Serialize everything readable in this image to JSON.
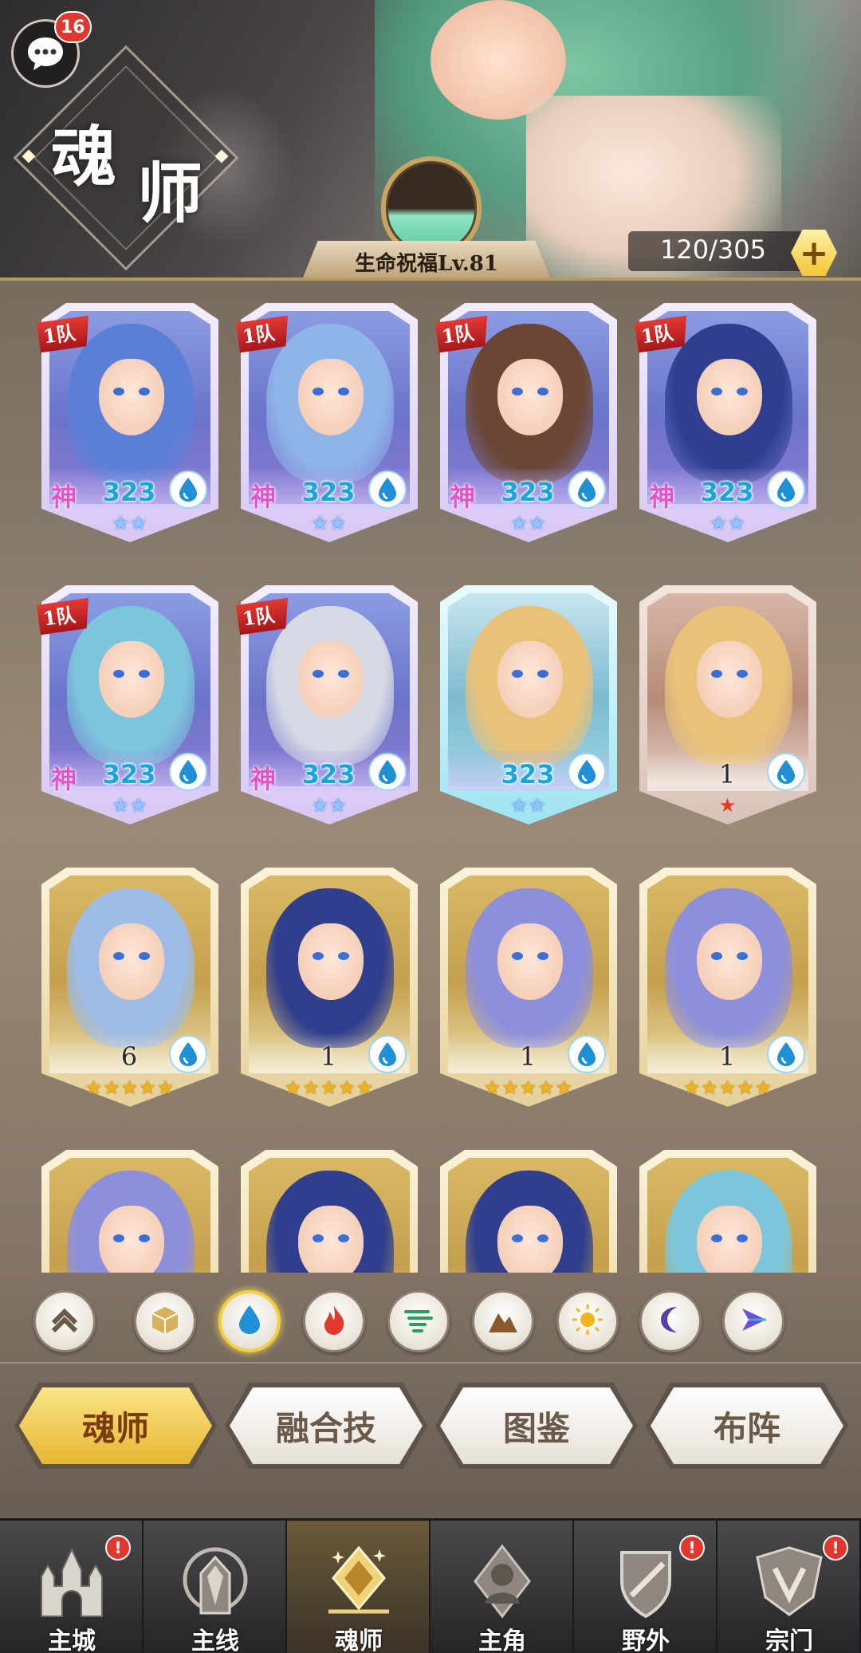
{
  "header": {
    "title_char_1": "魂",
    "title_char_2": "师",
    "chat_badge_count": "16",
    "blessing_label": "生命祝福Lv.81",
    "capacity": "120/305",
    "add_label": "+"
  },
  "cards": [
    {
      "team": "1队",
      "god": "神",
      "level": "323",
      "element": "water-icon",
      "stars": "★★",
      "style": "god",
      "hair": "#5b7fd6"
    },
    {
      "team": "1队",
      "god": "神",
      "level": "323",
      "element": "water-icon",
      "stars": "★★",
      "style": "god",
      "hair": "#8fb4e8"
    },
    {
      "team": "1队",
      "god": "神",
      "level": "323",
      "element": "water-icon",
      "stars": "★★",
      "style": "god",
      "hair": "#6b4634"
    },
    {
      "team": "1队",
      "god": "神",
      "level": "323",
      "element": "water-icon",
      "stars": "★★",
      "style": "god",
      "hair": "#2e3f8f"
    },
    {
      "team": "1队",
      "god": "神",
      "level": "323",
      "element": "water-icon",
      "stars": "★★",
      "style": "god",
      "hair": "#7cc6dc"
    },
    {
      "team": "1队",
      "god": "神",
      "level": "323",
      "element": "water-icon",
      "stars": "★★",
      "style": "god",
      "hair": "#d7dae4"
    },
    {
      "team": "",
      "god": "",
      "level": "323",
      "element": "water-icon",
      "stars": "★★",
      "style": "god-cyan",
      "hair": "#e9c27a"
    },
    {
      "team": "",
      "god": "",
      "level": "1",
      "element": "water-icon",
      "stars": "★",
      "style": "rose",
      "hair": "#e9c27a"
    },
    {
      "team": "",
      "god": "",
      "level": "6",
      "element": "water-icon",
      "stars": "★★★★★",
      "style": "gold",
      "hair": "#9dbde8"
    },
    {
      "team": "",
      "god": "",
      "level": "1",
      "element": "water-icon",
      "stars": "★★★★★",
      "style": "gold",
      "hair": "#2f3f8e"
    },
    {
      "team": "",
      "god": "",
      "level": "1",
      "element": "water-icon",
      "stars": "★★★★★",
      "style": "gold",
      "hair": "#8c8fdc"
    },
    {
      "team": "",
      "god": "",
      "level": "1",
      "element": "water-icon",
      "stars": "★★★★★",
      "style": "gold",
      "hair": "#8c8fdc"
    },
    {
      "team": "",
      "god": "",
      "level": "",
      "element": "",
      "stars": "",
      "style": "gold",
      "hair": "#8c8fdc"
    },
    {
      "team": "",
      "god": "",
      "level": "",
      "element": "",
      "stars": "",
      "style": "gold",
      "hair": "#2f3f8e"
    },
    {
      "team": "",
      "god": "",
      "level": "",
      "element": "",
      "stars": "",
      "style": "gold",
      "hair": "#2f3f8e"
    },
    {
      "team": "",
      "god": "",
      "level": "",
      "element": "",
      "stars": "",
      "style": "gold",
      "hair": "#7cc6dc"
    }
  ],
  "filters": [
    {
      "name": "sort-up-icon",
      "active": false
    },
    {
      "name": "all-box-icon",
      "active": false
    },
    {
      "name": "water-element-icon",
      "active": true
    },
    {
      "name": "fire-element-icon",
      "active": false
    },
    {
      "name": "wind-element-icon",
      "active": false
    },
    {
      "name": "earth-element-icon",
      "active": false
    },
    {
      "name": "light-element-icon",
      "active": false
    },
    {
      "name": "dark-element-icon",
      "active": false
    },
    {
      "name": "special-element-icon",
      "active": false
    }
  ],
  "tabs": [
    {
      "label": "魂师",
      "active": true
    },
    {
      "label": "融合技",
      "active": false
    },
    {
      "label": "图鉴",
      "active": false
    },
    {
      "label": "布阵",
      "active": false
    }
  ],
  "nav": [
    {
      "label": "主城",
      "badge": "!",
      "icon": "castle-icon",
      "active": false
    },
    {
      "label": "主线",
      "badge": "",
      "icon": "mainline-icon",
      "active": false
    },
    {
      "label": "魂师",
      "badge": "",
      "icon": "soul-master-icon",
      "active": true
    },
    {
      "label": "主角",
      "badge": "",
      "icon": "hero-icon",
      "active": false
    },
    {
      "label": "野外",
      "badge": "!",
      "icon": "wild-icon",
      "active": false
    },
    {
      "label": "宗门",
      "badge": "!",
      "icon": "sect-icon",
      "active": false
    }
  ],
  "colors": {
    "accent_gold": "#f3cf3a",
    "badge_red": "#e0372f",
    "level_blue": "#19a7d8",
    "god_pink": "#e552c8"
  }
}
